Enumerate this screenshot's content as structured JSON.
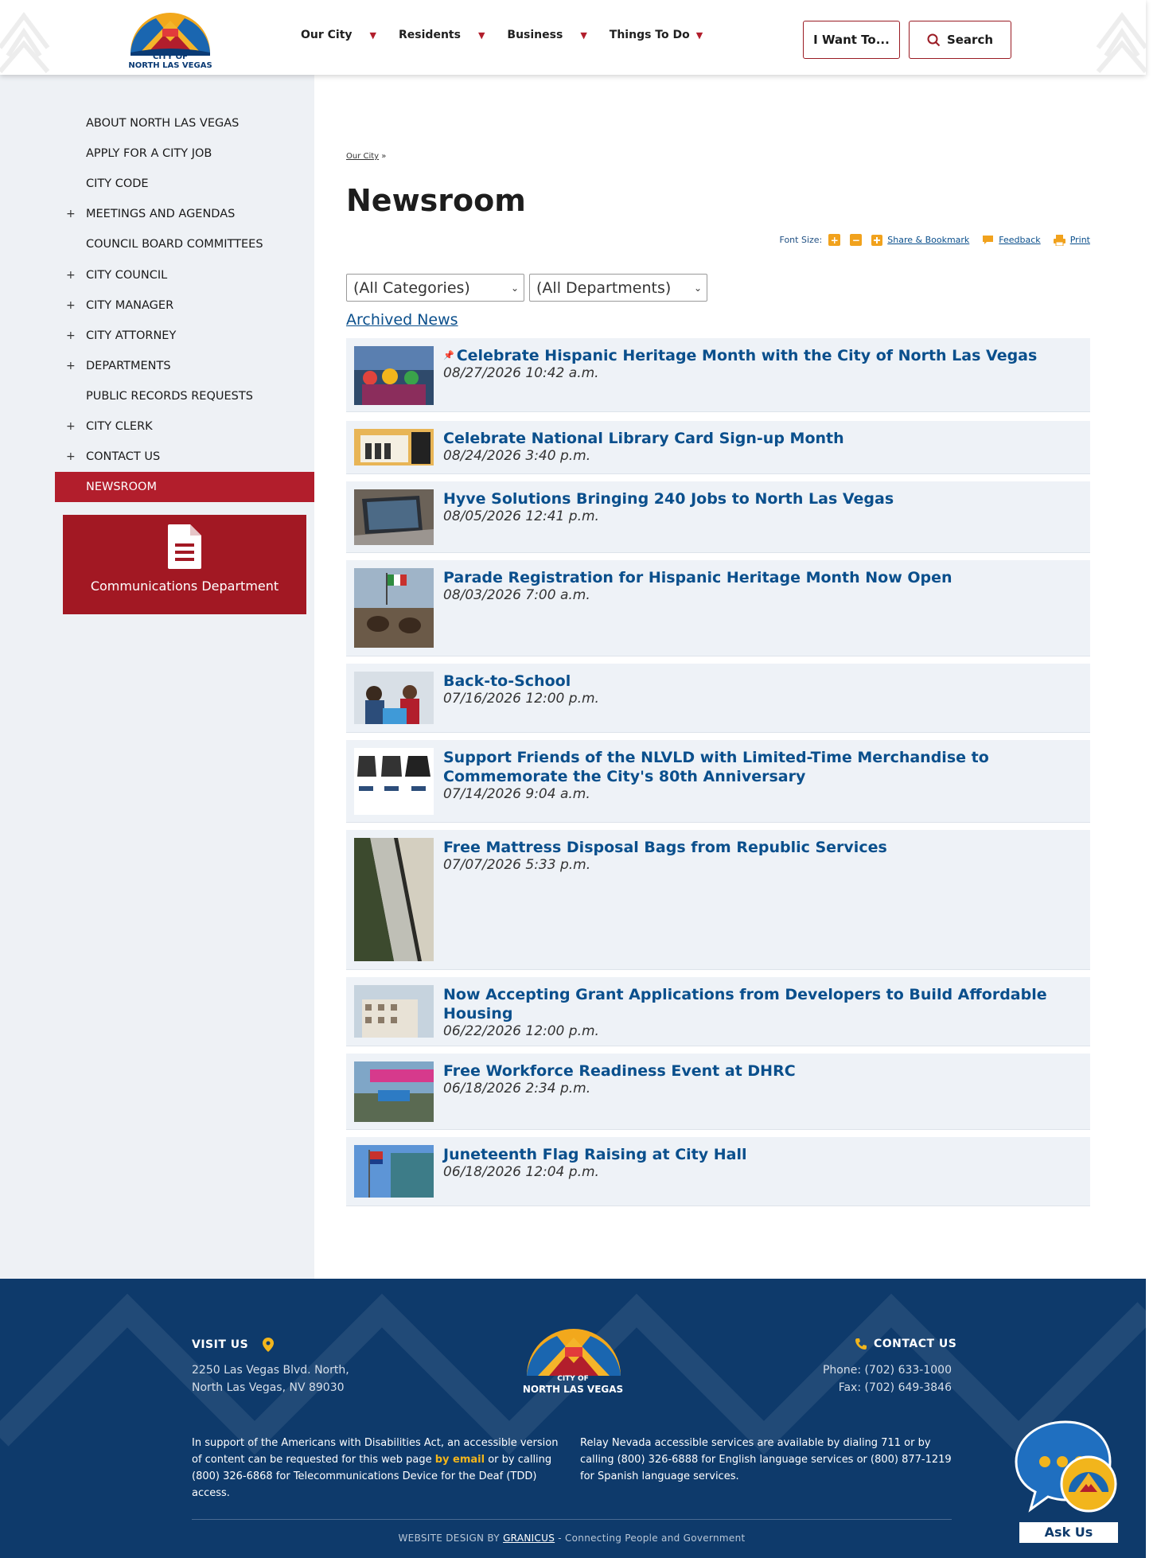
{
  "header": {
    "logo": {
      "line1": "CITY OF",
      "line2": "NORTH LAS VEGAS"
    },
    "nav": [
      {
        "label": "Our City"
      },
      {
        "label": "Residents"
      },
      {
        "label": "Business"
      },
      {
        "label": "Things To Do"
      }
    ],
    "i_want_label": "I Want To...",
    "search_label": "Search"
  },
  "sidebar": {
    "items": [
      {
        "label": "ABOUT NORTH LAS VEGAS",
        "expandable": false
      },
      {
        "label": "APPLY FOR A CITY JOB",
        "expandable": false
      },
      {
        "label": "CITY CODE",
        "expandable": false
      },
      {
        "label": "MEETINGS AND AGENDAS",
        "expandable": true
      },
      {
        "label": "COUNCIL BOARD COMMITTEES",
        "expandable": false
      },
      {
        "label": "CITY COUNCIL",
        "expandable": true
      },
      {
        "label": "CITY MANAGER",
        "expandable": true
      },
      {
        "label": "CITY ATTORNEY",
        "expandable": true
      },
      {
        "label": "DEPARTMENTS",
        "expandable": true
      },
      {
        "label": "PUBLIC RECORDS REQUESTS",
        "expandable": false
      },
      {
        "label": "CITY CLERK",
        "expandable": true
      },
      {
        "label": "CONTACT US",
        "expandable": true
      },
      {
        "label": "NEWSROOM",
        "expandable": false,
        "active": true
      }
    ],
    "plus_symbol": "+",
    "comm_label": "Communications Department"
  },
  "main": {
    "breadcrumb": "Our City",
    "breadcrumb_sep": "»",
    "title": "Newsroom",
    "tools": {
      "font_size_label": "Font Size:",
      "increase": "+",
      "decrease": "−",
      "share": "Share & Bookmark",
      "feedback": "Feedback",
      "print": "Print"
    },
    "category_select": "(All Categories)",
    "department_select": "(All Departments)",
    "archived_label": "Archived News",
    "news": [
      {
        "title": "Celebrate Hispanic Heritage Month with the City of North Las Vegas",
        "date": "08/27/2026 10:42 a.m.",
        "pinned": true,
        "thumb": "parade-costumes"
      },
      {
        "title": "Celebrate National Library Card Sign-up Month",
        "date": "08/24/2026 3:40 p.m.",
        "pinned": false,
        "thumb": "library-card"
      },
      {
        "title": "Hyve Solutions Bringing 240 Jobs to North Las Vegas",
        "date": "08/05/2026 12:41 p.m.",
        "pinned": false,
        "thumb": "laptop"
      },
      {
        "title": "Parade Registration for Hispanic Heritage Month Now Open",
        "date": "08/03/2026 7:00 a.m.",
        "pinned": false,
        "thumb": "horse-parade"
      },
      {
        "title": "Back-to-School",
        "date": "07/16/2026 12:00 p.m.",
        "pinned": false,
        "thumb": "school-kids"
      },
      {
        "title": "Support Friends of the NLVLD with Limited-Time Merchandise to Commemorate the City's 80th Anniversary",
        "date": "07/14/2026 9:04 a.m.",
        "pinned": false,
        "thumb": "merch-bags"
      },
      {
        "title": "Free Mattress Disposal Bags from Republic Services",
        "date": "07/07/2026 5:33 p.m.",
        "pinned": false,
        "thumb": "mattress"
      },
      {
        "title": "Now Accepting Grant Applications from Developers to Build Affordable Housing",
        "date": "06/22/2026 12:00 p.m.",
        "pinned": false,
        "thumb": "apartments"
      },
      {
        "title": "Free Workforce Readiness Event at DHRC",
        "date": "06/18/2026 2:34 p.m.",
        "pinned": false,
        "thumb": "tent-event"
      },
      {
        "title": "Juneteenth Flag Raising at City Hall",
        "date": "06/18/2026 12:04 p.m.",
        "pinned": false,
        "thumb": "flag-city-hall"
      }
    ]
  },
  "footer": {
    "visit_heading": "VISIT US",
    "address_line1": "2250 Las Vegas Blvd. North,",
    "address_line2": "North Las Vegas, NV 89030",
    "contact_heading": "CONTACT US",
    "phone": "Phone: (702) 633-1000",
    "fax": "Fax: (702) 649-3846",
    "logo_line1": "CITY OF",
    "logo_line2": "NORTH LAS VEGAS",
    "ada_before": "In support of the Americans with Disabilities Act, an accessible version of content can be requested for this web page ",
    "ada_link": "by email",
    "ada_after": " or by calling (800) 326-6868 for Telecommunications Device for the Deaf (TDD) access.",
    "relay": "Relay Nevada accessible services are available by dialing 711 or by calling (800) 326-6888 for English language services or (800) 877-1219 for Spanish language services.",
    "credit_before": "WEBSITE DESIGN BY ",
    "credit_link": "GRANICUS",
    "credit_after": " - Connecting People and Government",
    "ask_us": "Ask Us"
  },
  "colors": {
    "brand_red": "#b21e2c",
    "brand_blue": "#0e3a6b",
    "link_blue": "#0a4f8c",
    "accent_orange": "#f1a21d"
  }
}
